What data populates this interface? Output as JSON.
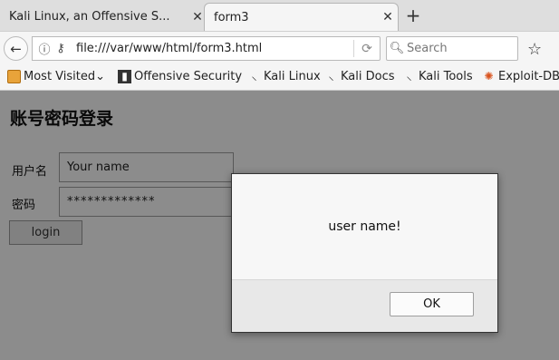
{
  "tabs": [
    {
      "title": "Kali Linux, an Offensive S...",
      "close": "✕"
    },
    {
      "title": "form3",
      "close": "✕"
    }
  ],
  "new_tab": "+",
  "nav": {
    "back": "←",
    "url": "file:///var/www/html/form3.html",
    "reload": "⟳",
    "search_placeholder": "Search",
    "star": "☆"
  },
  "bookmarks": [
    {
      "label": "Most Visited",
      "suffix": "⌄"
    },
    {
      "label": "Offensive Security"
    },
    {
      "label": "Kali Linux"
    },
    {
      "label": "Kali Docs"
    },
    {
      "label": "Kali Tools"
    },
    {
      "label": "Exploit-DB"
    }
  ],
  "page": {
    "heading": "账号密码登录",
    "username_label": "用户名",
    "username_value": "Your name",
    "password_label": "密码",
    "password_value": "*************",
    "login_label": "login"
  },
  "dialog": {
    "message": "user name!",
    "ok_label": "OK"
  }
}
